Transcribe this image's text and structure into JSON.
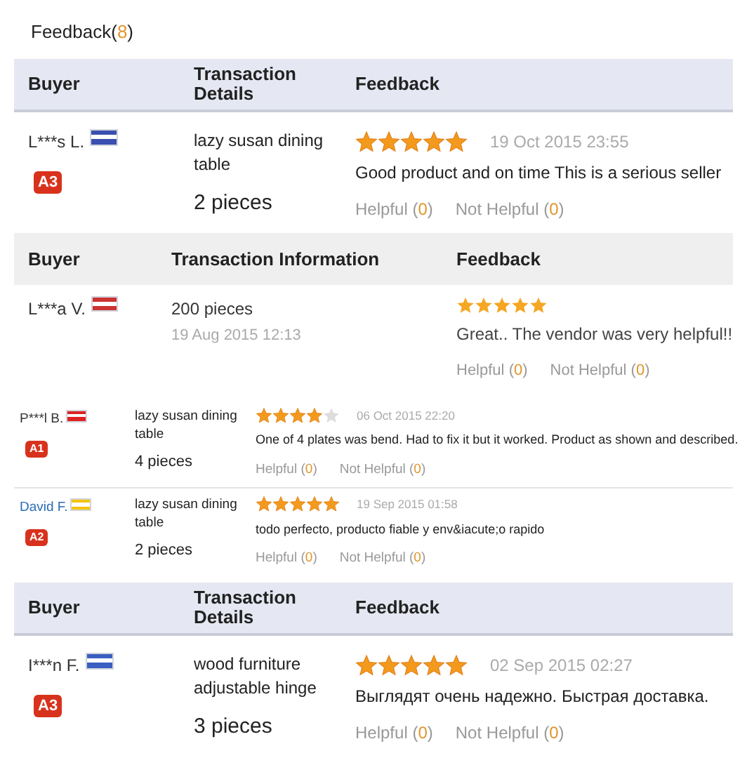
{
  "title": "Feedback",
  "count": "(8)",
  "sections": [
    {
      "kind": "details",
      "columns": [
        "Buyer",
        "Transaction Details",
        "Feedback"
      ],
      "rows": [
        {
          "buyer": "L***s L.",
          "linked": false,
          "color": "#3a4fb0",
          "badge": "A3",
          "product": "lazy susan dining table",
          "quantity": "2 pieces",
          "stars": 5,
          "date": "19 Oct 2015 23:55",
          "comment": "Good product and on time This is a serious seller",
          "helpful": "Helpful",
          "helpful_count": "(0)",
          "not_helpful": "Not Helpful",
          "not_helpful_count": "(0)"
        }
      ]
    },
    {
      "kind": "info",
      "columns": [
        "Buyer",
        "Transaction Information",
        "Feedback"
      ],
      "rows": [
        {
          "buyer": "L***a V.",
          "linked": false,
          "color": "#cc3333",
          "quantity": "200 pieces",
          "date": "19 Aug 2015 12:13",
          "stars": 5,
          "comment": "Great.. The vendor was very helpful!!",
          "helpful": "Helpful",
          "helpful_count": "(0)",
          "not_helpful": "Not Helpful",
          "not_helpful_count": "(0)"
        }
      ]
    },
    {
      "kind": "compact",
      "rows": [
        {
          "buyer": "P***l B.",
          "linked": false,
          "color": "#dd2222",
          "badge": "A1",
          "product": "lazy susan dining table",
          "quantity": "4 pieces",
          "stars": 4,
          "date": "06 Oct 2015 22:20",
          "comment": "One of 4 plates was bend. Had to fix it but it worked. Product as shown and described.",
          "helpful": "Helpful",
          "helpful_count": "(0)",
          "not_helpful": "Not Helpful",
          "not_helpful_count": "(0)"
        },
        {
          "buyer": "David F.",
          "linked": true,
          "color": "#f5c400",
          "badge": "A2",
          "product": "lazy susan dining table",
          "quantity": "2 pieces",
          "stars": 5,
          "date": "19 Sep 2015 01:58",
          "comment": "todo perfecto, producto fiable y env&iacute;o rapido",
          "helpful": "Helpful",
          "helpful_count": "(0)",
          "not_helpful": "Not Helpful",
          "not_helpful_count": "(0)"
        }
      ]
    },
    {
      "kind": "details",
      "columns": [
        "Buyer",
        "Transaction Details",
        "Feedback"
      ],
      "rows": [
        {
          "buyer": "I***n F.",
          "linked": false,
          "color": "#3a5fc0",
          "badge": "A3",
          "product": "wood furniture adjustable hinge",
          "quantity": "3 pieces",
          "stars": 5,
          "date": "02 Sep 2015 02:27",
          "comment": "Выглядят очень надежно. Быстрая доставка.",
          "helpful": "Helpful",
          "helpful_count": "(0)",
          "not_helpful": "Not Helpful",
          "not_helpful_count": "(0)"
        }
      ]
    }
  ]
}
